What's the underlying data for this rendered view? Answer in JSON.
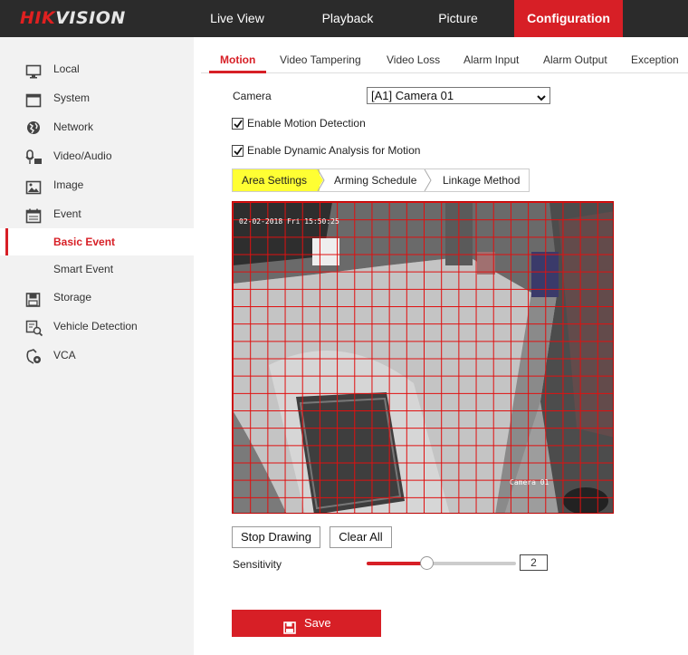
{
  "brand": {
    "logo_hik": "HIK",
    "logo_vision": "VISION"
  },
  "topnav": [
    {
      "label": "Live View"
    },
    {
      "label": "Playback"
    },
    {
      "label": "Picture"
    },
    {
      "label": "Configuration",
      "active": true
    }
  ],
  "sidebar": {
    "items": [
      {
        "label": "Local",
        "icon": "monitor-icon"
      },
      {
        "label": "System",
        "icon": "window-icon"
      },
      {
        "label": "Network",
        "icon": "globe-icon"
      },
      {
        "label": "Video/Audio",
        "icon": "microphone-icon"
      },
      {
        "label": "Image",
        "icon": "image-icon"
      },
      {
        "label": "Event",
        "icon": "calendar-icon"
      },
      {
        "label": "Basic Event",
        "active": true
      },
      {
        "label": "Smart Event"
      },
      {
        "label": "Storage",
        "icon": "floppy-icon"
      },
      {
        "label": "Vehicle Detection",
        "icon": "vehicle-search-icon"
      },
      {
        "label": "VCA",
        "icon": "vca-gear-icon"
      }
    ]
  },
  "tabs": [
    {
      "label": "Motion",
      "active": true
    },
    {
      "label": "Video Tampering"
    },
    {
      "label": "Video Loss"
    },
    {
      "label": "Alarm Input"
    },
    {
      "label": "Alarm Output"
    },
    {
      "label": "Exception"
    }
  ],
  "form": {
    "camera_label": "Camera",
    "camera_value": "[A1] Camera 01",
    "enable_motion_label": "Enable Motion Detection",
    "enable_motion_checked": true,
    "enable_dynamic_label": "Enable Dynamic Analysis for Motion",
    "enable_dynamic_checked": true
  },
  "subtabs": [
    {
      "label": "Area Settings",
      "active": true
    },
    {
      "label": "Arming Schedule"
    },
    {
      "label": "Linkage Method"
    }
  ],
  "video": {
    "osd_timestamp": "02-02-2018 Fri 15:50:25",
    "osd_camera": "Camera 01",
    "grid_color": "#e01010"
  },
  "buttons": {
    "stop_drawing": "Stop Drawing",
    "clear_all": "Clear All",
    "save": "Save"
  },
  "sensitivity": {
    "label": "Sensitivity",
    "value": "2",
    "level_fraction": 0.4
  },
  "colors": {
    "accent": "#d71f26",
    "topbar": "#2b2b2b",
    "sidebar": "#f2f2f2"
  }
}
